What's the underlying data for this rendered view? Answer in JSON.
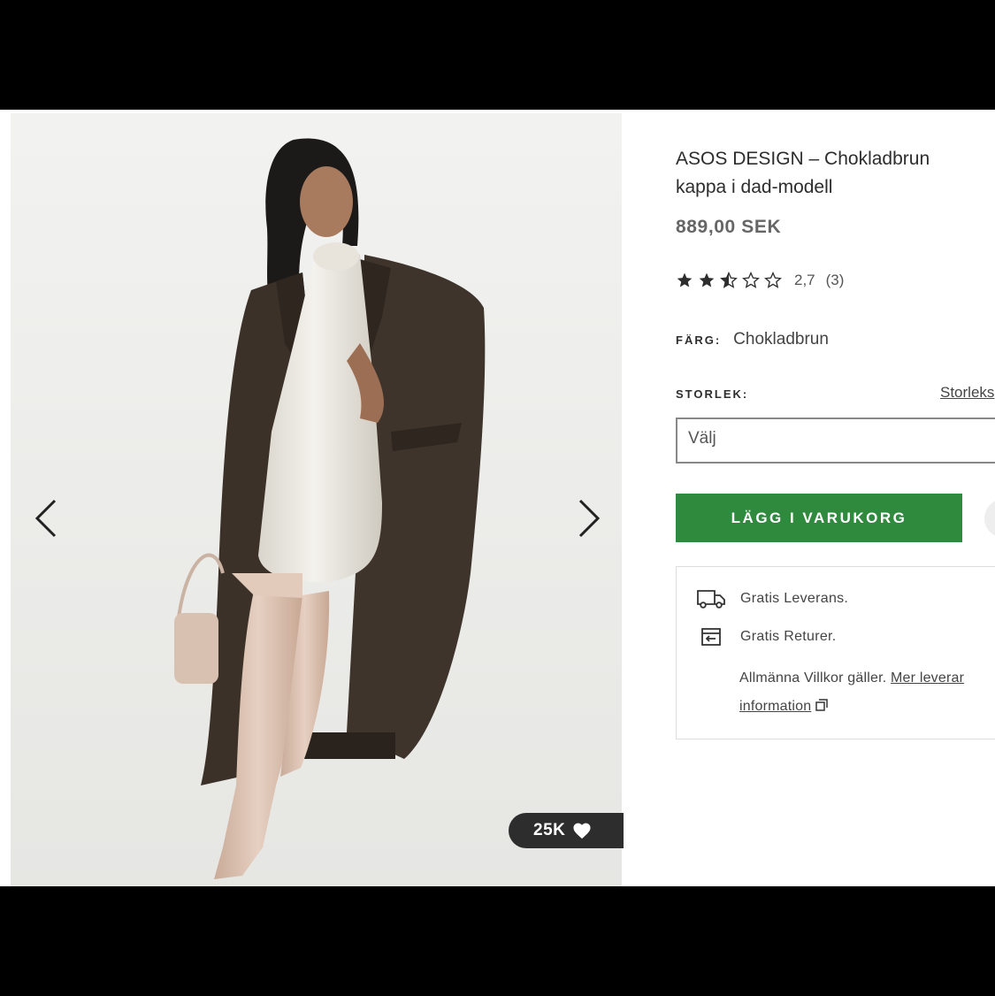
{
  "product": {
    "title": "ASOS DESIGN – Chokladbrun kappa i dad-modell",
    "price": "889,00 SEK",
    "rating": {
      "value": "2,7",
      "count": "(3)",
      "stars_filled": 2.5,
      "stars_total": 5
    },
    "color_label": "FÄRG:",
    "color_value": "Chokladbrun",
    "size_label": "STORLEK:",
    "size_guide": "Storleks",
    "size_placeholder": "Välj",
    "add_to_bag": "LÄGG I VARUKORG"
  },
  "gallery": {
    "likes": "25K",
    "like_icon": "heart-icon"
  },
  "delivery": {
    "free_delivery": "Gratis Leverans.",
    "free_returns": "Gratis Returer.",
    "terms_text": "Allmänna Villkor gäller.",
    "more_info_link_1": "Mer leverar",
    "more_info_link_2": "information"
  },
  "colors": {
    "accent_green": "#2f8a3e",
    "text": "#2d2d2d"
  }
}
